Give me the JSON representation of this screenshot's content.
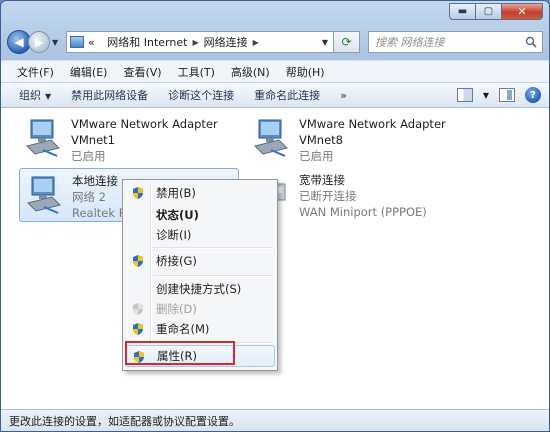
{
  "window": {
    "caption_min": "▬",
    "caption_max": "▢",
    "caption_close": "✕"
  },
  "address": {
    "back_glyph": "◀",
    "forward_glyph": "▶",
    "prefix": "«",
    "segments": [
      "网络和 Internet",
      "网络连接"
    ],
    "search_placeholder": "搜索 网络连接"
  },
  "menubar": {
    "items": [
      "文件(F)",
      "编辑(E)",
      "查看(V)",
      "工具(T)",
      "高级(N)",
      "帮助(H)"
    ]
  },
  "cmdbar": {
    "items": [
      "组织",
      "禁用此网络设备",
      "诊断这个连接",
      "重命名此连接",
      "»"
    ],
    "help": "?"
  },
  "connections": [
    {
      "name": "VMware Network Adapter",
      "sub": "VMnet1",
      "status": "已启用"
    },
    {
      "name": "VMware Network Adapter",
      "sub": "VMnet8",
      "status": "已启用"
    },
    {
      "name": "本地连接",
      "sub": "网络  2",
      "status": "Realtek PCIe"
    },
    {
      "name": "宽带连接",
      "sub": "已断开连接",
      "status": "WAN Miniport (PPPOE)"
    }
  ],
  "context_menu": {
    "items": [
      {
        "label": "禁用(B)"
      },
      {
        "label": "状态(U)"
      },
      {
        "label": "诊断(I)"
      },
      {
        "label": "桥接(G)"
      },
      {
        "label": "创建快捷方式(S)"
      },
      {
        "label": "删除(D)"
      },
      {
        "label": "重命名(M)"
      },
      {
        "label": "属性(R)"
      }
    ]
  },
  "status_bar": {
    "text": "更改此连接的设置，如适配器或协议配置设置。"
  },
  "colors": {
    "highlight_border": "#d32b2b",
    "selection_bg": "#d4e6fa",
    "shield_blue": "#2c6fd1",
    "shield_yellow": "#f2c414"
  }
}
